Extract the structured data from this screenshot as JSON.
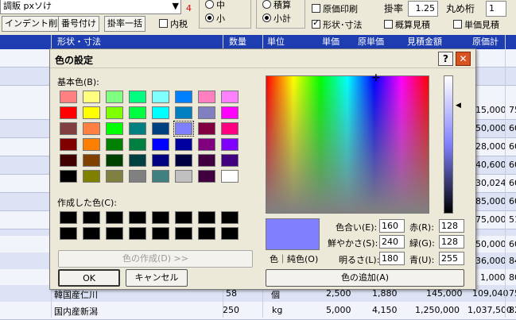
{
  "toolbar": {
    "field_top": "調販 pxソけ",
    "red_number": "4",
    "btn_indent_delete": "インデント削除",
    "btn_number": "番号付け",
    "btn_rate_all": "掛率一括",
    "chk_tax_incl": "内税",
    "radio_mid": "中",
    "radio_small": "小",
    "radio_sum": "積算",
    "radio_subtotal": "小計",
    "chk_cost_print": "原価印刷",
    "rate_label": "掛率",
    "rate_value": "1.25",
    "round_label": "丸め桁",
    "round_value": "1",
    "chk_shape": "形状･寸法",
    "chk_estimate_approx": "概算見積",
    "chk_unit_estimate": "単価見積"
  },
  "header": {
    "col_shape": "形状・寸法",
    "col_qty": "数量",
    "col_unit": "単位",
    "col_unit_price": "単価",
    "col_cost_price": "原単価",
    "col_estimate": "見積金額",
    "col_cost_total": "原価計"
  },
  "grid_rows": [
    {
      "cost_total": "15,000",
      "extra": "75"
    },
    {
      "cost_total": "50,000",
      "extra": "60"
    },
    {
      "cost_total": "28,000",
      "extra": "60"
    },
    {
      "cost_total": "40,600",
      "extra": "60"
    },
    {
      "cost_total": "30,024",
      "extra": "60"
    },
    {
      "cost_total": "85,000",
      "extra": "60"
    },
    {
      "cost_total": "75,000",
      "extra": "51"
    },
    {
      "cost_total": "50,000",
      "extra": "60"
    },
    {
      "cost_total": "36,000",
      "extra": "84"
    },
    {
      "cost_total": "1,000",
      "extra": "80"
    }
  ],
  "row_korea": {
    "name": "韓国産仁川",
    "qty": "58",
    "unit": "個",
    "unit_price": "2,500",
    "cost_price": "1,880",
    "estimate": "145,000",
    "cost_total": "109,040",
    "extra": "75"
  },
  "row_niigata": {
    "name": "国内産新潟",
    "qty": "250",
    "unit": "kg",
    "unit_price": "5,000",
    "cost_price": "4,150",
    "estimate": "1,250,000",
    "cost_total": "1,037,500",
    "extra": "82"
  },
  "dialog": {
    "title": "色の設定",
    "help_btn": "?",
    "close_btn": "✕",
    "basic_colors_label": "基本色(B):",
    "custom_colors_label": "作成した色(C):",
    "define_custom_btn": "色の作成(D) >>",
    "ok_btn": "OK",
    "cancel_btn": "キャンセル",
    "color_solid_label": "色｜純色(O)",
    "hue_label": "色合い(E):",
    "hue_value": "160",
    "sat_label": "鮮やかさ(S):",
    "sat_value": "240",
    "lum_label": "明るさ(L):",
    "lum_value": "180",
    "red_label": "赤(R):",
    "red_value": "128",
    "green_label": "緑(G):",
    "green_value": "128",
    "blue_label": "青(U):",
    "blue_value": "255",
    "add_custom_btn": "色の追加(A)",
    "selected_color": "#8080ff",
    "basic_colors": [
      "#ff8080",
      "#ffff80",
      "#80ff80",
      "#00ff80",
      "#80ffff",
      "#0080ff",
      "#ff80c0",
      "#ff80ff",
      "#ff0000",
      "#ffff00",
      "#80ff00",
      "#00ff40",
      "#00ffff",
      "#0080c0",
      "#8080c0",
      "#ff00ff",
      "#804040",
      "#ff8040",
      "#00ff00",
      "#008080",
      "#004080",
      "#8080ff",
      "#800040",
      "#ff0080",
      "#800000",
      "#ff8000",
      "#008000",
      "#008040",
      "#0000ff",
      "#0000a0",
      "#800080",
      "#8000ff",
      "#400000",
      "#804000",
      "#004000",
      "#004040",
      "#000080",
      "#000040",
      "#400040",
      "#400080",
      "#000000",
      "#808000",
      "#808040",
      "#808080",
      "#408080",
      "#c0c0c0",
      "#400040",
      "#ffffff"
    ]
  }
}
